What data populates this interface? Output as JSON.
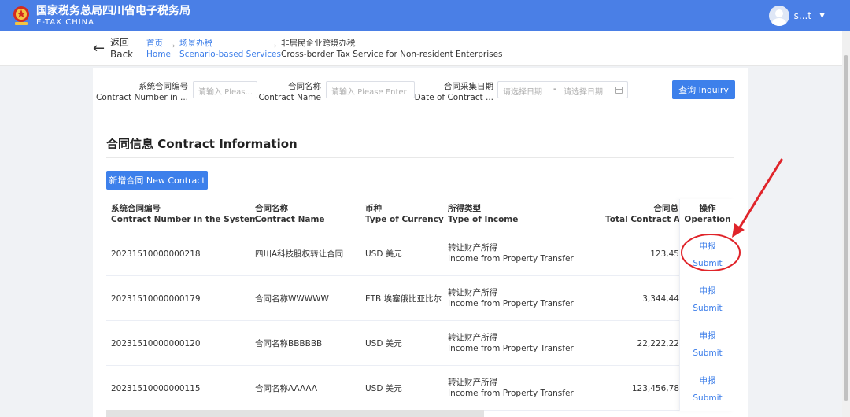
{
  "header": {
    "brand_cn": "国家税务总局四川省电子税务局",
    "brand_en": "E-TAX CHINA",
    "user_name": "s...t",
    "accent_color": "#4a7fe6"
  },
  "breadcrumb": {
    "back_cn": "返回",
    "back_en": "Back",
    "items": [
      {
        "cn": "首页",
        "en": "Home"
      },
      {
        "cn": "场景办税",
        "en": "Scenario-based Services"
      },
      {
        "cn": "非居民企业跨境办税",
        "en": "Cross-border Tax Service for Non-resident Enterprises"
      }
    ]
  },
  "filters": {
    "contract_number": {
      "label_cn": "系统合同编号",
      "label_en": "Contract Number in ...",
      "placeholder": "请输入 Pleas..."
    },
    "contract_name": {
      "label_cn": "合同名称",
      "label_en": "Contract Name",
      "placeholder": "请输入 Please Enter"
    },
    "collect_date": {
      "label_cn": "合同采集日期",
      "label_en": "Date of Contract ...",
      "start_placeholder": "请选择日期",
      "end_placeholder": "请选择日期",
      "separator": "-"
    },
    "inquiry_label": "查询 Inquiry"
  },
  "section": {
    "title": "合同信息 Contract Information",
    "new_contract_label": "新增合同 New Contract"
  },
  "table": {
    "headers": [
      {
        "cn": "系统合同编号",
        "en": "Contract Number in the System"
      },
      {
        "cn": "合同名称",
        "en": "Contract Name"
      },
      {
        "cn": "币种",
        "en": "Type of Currency"
      },
      {
        "cn": "所得类型",
        "en": "Type of Income"
      },
      {
        "cn": "合同总",
        "en": "Total Contract Amc"
      },
      {
        "cn": "操作",
        "en": "Operation"
      }
    ],
    "rows": [
      {
        "number": "20231510000000218",
        "name": "四川A科技股权转让合同",
        "currency": "USD 美元",
        "income_cn": "转让财产所得",
        "income_en": "Income from Property Transfer",
        "amount": "123,45",
        "op_cn": "申报",
        "op_en": "Submit"
      },
      {
        "number": "20231510000000179",
        "name": "合同名称WWWWW",
        "currency": "ETB 埃塞俄比亚比尔",
        "income_cn": "转让财产所得",
        "income_en": "Income from Property Transfer",
        "amount": "3,344,44",
        "op_cn": "申报",
        "op_en": "Submit"
      },
      {
        "number": "20231510000000120",
        "name": "合同名称BBBBBB",
        "currency": "USD 美元",
        "income_cn": "转让财产所得",
        "income_en": "Income from Property Transfer",
        "amount": "22,222,22",
        "op_cn": "申报",
        "op_en": "Submit"
      },
      {
        "number": "20231510000000115",
        "name": "合同名称AAAAA",
        "currency": "USD 美元",
        "income_cn": "转让财产所得",
        "income_en": "Income from Property Transfer",
        "amount": "123,456,78",
        "op_cn": "申报",
        "op_en": "Submit"
      }
    ]
  },
  "annotation_color": "#e0242a"
}
